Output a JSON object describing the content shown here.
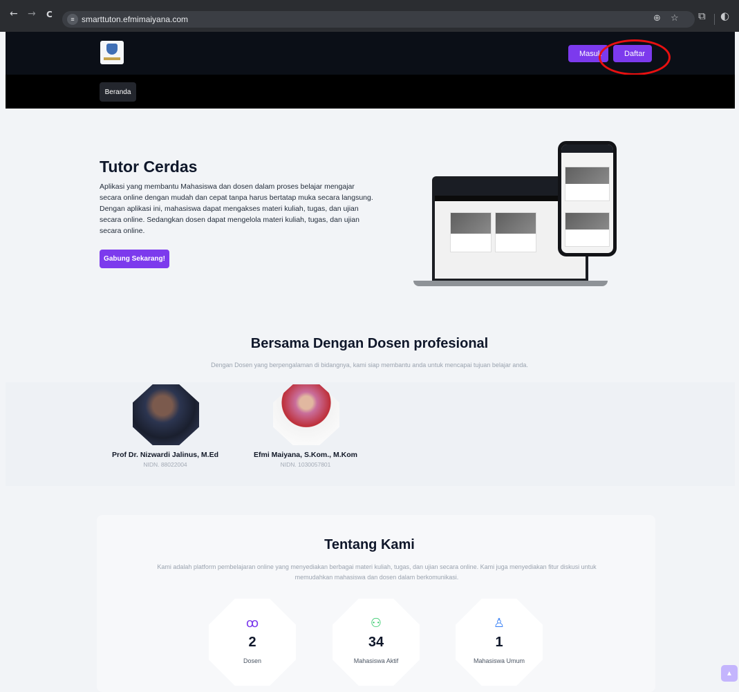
{
  "browser": {
    "url": "smarttuton.efmimaiyana.com",
    "back": "←",
    "forward": "→",
    "reload": "C",
    "zoom_icon": "⊕",
    "star_icon": "☆",
    "ext_icon": "⧉",
    "profile_icon": "◐"
  },
  "header": {
    "masuk_label": "Masuk",
    "daftar_label": "Daftar",
    "nav": [
      {
        "label": "Beranda"
      }
    ]
  },
  "hero": {
    "title": "Tutor Cerdas",
    "paragraph1": "Aplikasi yang membantu Mahasiswa dan dosen dalam proses belajar mengajar secara online dengan mudah dan cepat tanpa harus bertatap muka secara langsung.",
    "paragraph2": "Dengan aplikasi ini, mahasiswa dapat mengakses materi kuliah, tugas, dan ujian secara online. Sedangkan dosen dapat mengelola materi kuliah, tugas, dan ujian secara online.",
    "cta": "Gabung Sekarang!"
  },
  "dosen_section": {
    "title": "Bersama Dengan Dosen profesional",
    "subtitle": "Dengan Dosen yang berpengalaman di bidangnya, kami siap membantu anda untuk mencapai tujuan belajar anda.",
    "lecturers": [
      {
        "name": "Prof Dr. Nizwardi Jalinus, M.Ed",
        "nidn": "NIDN. 88022004"
      },
      {
        "name": "Efmi Maiyana, S.Kom., M.Kom",
        "nidn": "NIDN. 1030057801"
      }
    ]
  },
  "about": {
    "title": "Tentang Kami",
    "text": "Kami adalah platform pembelajaran online yang menyediakan berbagai materi kuliah, tugas, dan ujian secara online. Kami juga menyediakan fitur diskusi untuk memudahkan mahasiswa dan dosen dalam berkomunikasi.",
    "stats": [
      {
        "value": "2",
        "label": "Dosen",
        "icon": "users-icon",
        "color": "#7c3aed"
      },
      {
        "value": "34",
        "label": "Mahasiswa Aktif",
        "icon": "network-icon",
        "color": "#22c55e"
      },
      {
        "value": "1",
        "label": "Mahasiswa Umum",
        "icon": "user-check-icon",
        "color": "#3b82f6"
      }
    ]
  },
  "colors": {
    "accent": "#7c3aed",
    "highlight": "#e81010",
    "dark": "#0b0f17"
  }
}
